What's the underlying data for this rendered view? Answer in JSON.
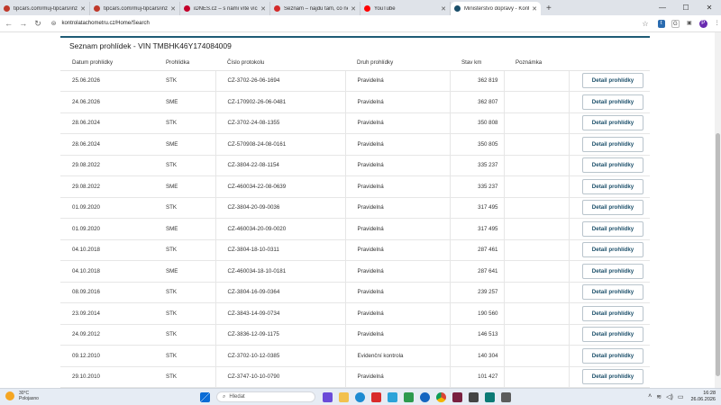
{
  "browser": {
    "tabs": [
      {
        "title": "tipcars.com/muj-tipcars/inzerce",
        "color": "#c0392b",
        "active": false
      },
      {
        "title": "tipcars.com/muj-tipcars/inzerce",
        "color": "#c0392b",
        "active": false
      },
      {
        "title": "iDNES.cz – s námi víte víc",
        "color": "#c4002b",
        "active": false
      },
      {
        "title": "Seznam – najdu tam, co nezná…",
        "color": "#d42b2b",
        "active": false
      },
      {
        "title": "YouTube",
        "color": "#ff0000",
        "active": false
      },
      {
        "title": "Ministerstvo dopravy - Kontrol…",
        "color": "#1b4f6a",
        "active": true
      }
    ],
    "new_tab": "+",
    "url": "kontrolatachometru.cz/Home/Search",
    "ext1": "t",
    "ext2": "G",
    "profile": "P"
  },
  "page": {
    "title": "Seznam prohlídek - VIN TMBHK46Y174084009",
    "columns": [
      "Datum prohlídky",
      "Prohlídka",
      "Číslo protokolu",
      "Druh prohlídky",
      "Stav km",
      "Poznámka"
    ],
    "detail_label": "Detail prohlídky",
    "rows": [
      {
        "date": "25.06.2026",
        "type": "STK",
        "protocol": "CZ-3702-26-06-1694",
        "kind": "Pravidelná",
        "km": "362 819",
        "note": ""
      },
      {
        "date": "24.06.2026",
        "type": "SME",
        "protocol": "CZ-170902-26-06-0481",
        "kind": "Pravidelná",
        "km": "362 807",
        "note": ""
      },
      {
        "date": "28.06.2024",
        "type": "STK",
        "protocol": "CZ-3702-24-08-1355",
        "kind": "Pravidelná",
        "km": "350 808",
        "note": ""
      },
      {
        "date": "28.06.2024",
        "type": "SME",
        "protocol": "CZ-570908-24-08-0161",
        "kind": "Pravidelná",
        "km": "350 805",
        "note": ""
      },
      {
        "date": "29.08.2022",
        "type": "STK",
        "protocol": "CZ-3804-22-08-1154",
        "kind": "Pravidelná",
        "km": "335 237",
        "note": ""
      },
      {
        "date": "29.08.2022",
        "type": "SME",
        "protocol": "CZ-460034-22-08-0639",
        "kind": "Pravidelná",
        "km": "335 237",
        "note": ""
      },
      {
        "date": "01.09.2020",
        "type": "STK",
        "protocol": "CZ-3804-20-09-0036",
        "kind": "Pravidelná",
        "km": "317 495",
        "note": ""
      },
      {
        "date": "01.09.2020",
        "type": "SME",
        "protocol": "CZ-460034-20-09-0020",
        "kind": "Pravidelná",
        "km": "317 495",
        "note": ""
      },
      {
        "date": "04.10.2018",
        "type": "STK",
        "protocol": "CZ-3804-18-10-0311",
        "kind": "Pravidelná",
        "km": "287 461",
        "note": ""
      },
      {
        "date": "04.10.2018",
        "type": "SME",
        "protocol": "CZ-460034-18-10-0181",
        "kind": "Pravidelná",
        "km": "287 641",
        "note": ""
      },
      {
        "date": "08.09.2016",
        "type": "STK",
        "protocol": "CZ-3804-16-09-0364",
        "kind": "Pravidelná",
        "km": "239 257",
        "note": ""
      },
      {
        "date": "23.09.2014",
        "type": "STK",
        "protocol": "CZ-3843-14-09-0734",
        "kind": "Pravidelná",
        "km": "190 560",
        "note": ""
      },
      {
        "date": "24.09.2012",
        "type": "STK",
        "protocol": "CZ-3836-12-09-1175",
        "kind": "Pravidelná",
        "km": "146 513",
        "note": ""
      },
      {
        "date": "09.12.2010",
        "type": "STK",
        "protocol": "CZ-3702-10-12-0385",
        "kind": "Evidenční kontrola",
        "km": "140 304",
        "note": ""
      },
      {
        "date": "29.10.2010",
        "type": "STK",
        "protocol": "CZ-3747-10-10-0790",
        "kind": "Pravidelná",
        "km": "101 427",
        "note": ""
      }
    ]
  },
  "taskbar": {
    "weather_temp": "30°C",
    "weather_desc": "Polojasno",
    "search_placeholder": "Hledat",
    "time": "16:28",
    "date": "26.06.2026"
  }
}
